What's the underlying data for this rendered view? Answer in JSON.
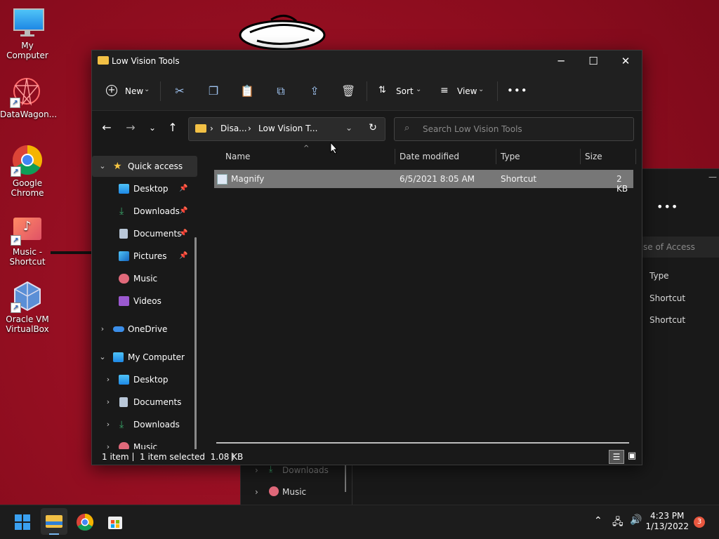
{
  "desktop": {
    "icons": [
      {
        "label": "My Computer"
      },
      {
        "label": "DataWagon..."
      },
      {
        "label": "Google Chrome"
      },
      {
        "label": "Music - Shortcut"
      },
      {
        "label": "Oracle VM VirtualBox"
      }
    ]
  },
  "background_window": {
    "crumb": "se of Access",
    "col_type": "Type",
    "rows": [
      "Shortcut",
      "Shortcut"
    ],
    "sidebar": [
      "Downloads",
      "Music"
    ]
  },
  "window": {
    "title": "Low Vision Tools",
    "toolbar": {
      "new_label": "New",
      "sort_label": "Sort",
      "view_label": "View"
    },
    "address": {
      "crumb1": "Disa...",
      "crumb2": "Low Vision T..."
    },
    "search": {
      "placeholder": "Search Low Vision Tools"
    },
    "sidebar": {
      "quick_access": "Quick access",
      "pinned": [
        {
          "label": "Desktop"
        },
        {
          "label": "Downloads"
        },
        {
          "label": "Documents"
        },
        {
          "label": "Pictures"
        }
      ],
      "unpinned": [
        {
          "label": "Music"
        },
        {
          "label": "Videos"
        }
      ],
      "onedrive": "OneDrive",
      "my_computer": "My Computer",
      "computer_items": [
        {
          "label": "Desktop"
        },
        {
          "label": "Documents"
        },
        {
          "label": "Downloads"
        },
        {
          "label": "Music"
        }
      ]
    },
    "columns": [
      "Name",
      "Date modified",
      "Type",
      "Size"
    ],
    "files": [
      {
        "name": "Magnify",
        "date": "6/5/2021 8:05 AM",
        "type": "Shortcut",
        "size": "2 KB"
      }
    ],
    "status": {
      "count": "1 item",
      "selection": "1 item selected  1.08 KB"
    }
  },
  "taskbar": {
    "time": "4:23 PM",
    "date": "1/13/2022",
    "notifications": "3"
  }
}
